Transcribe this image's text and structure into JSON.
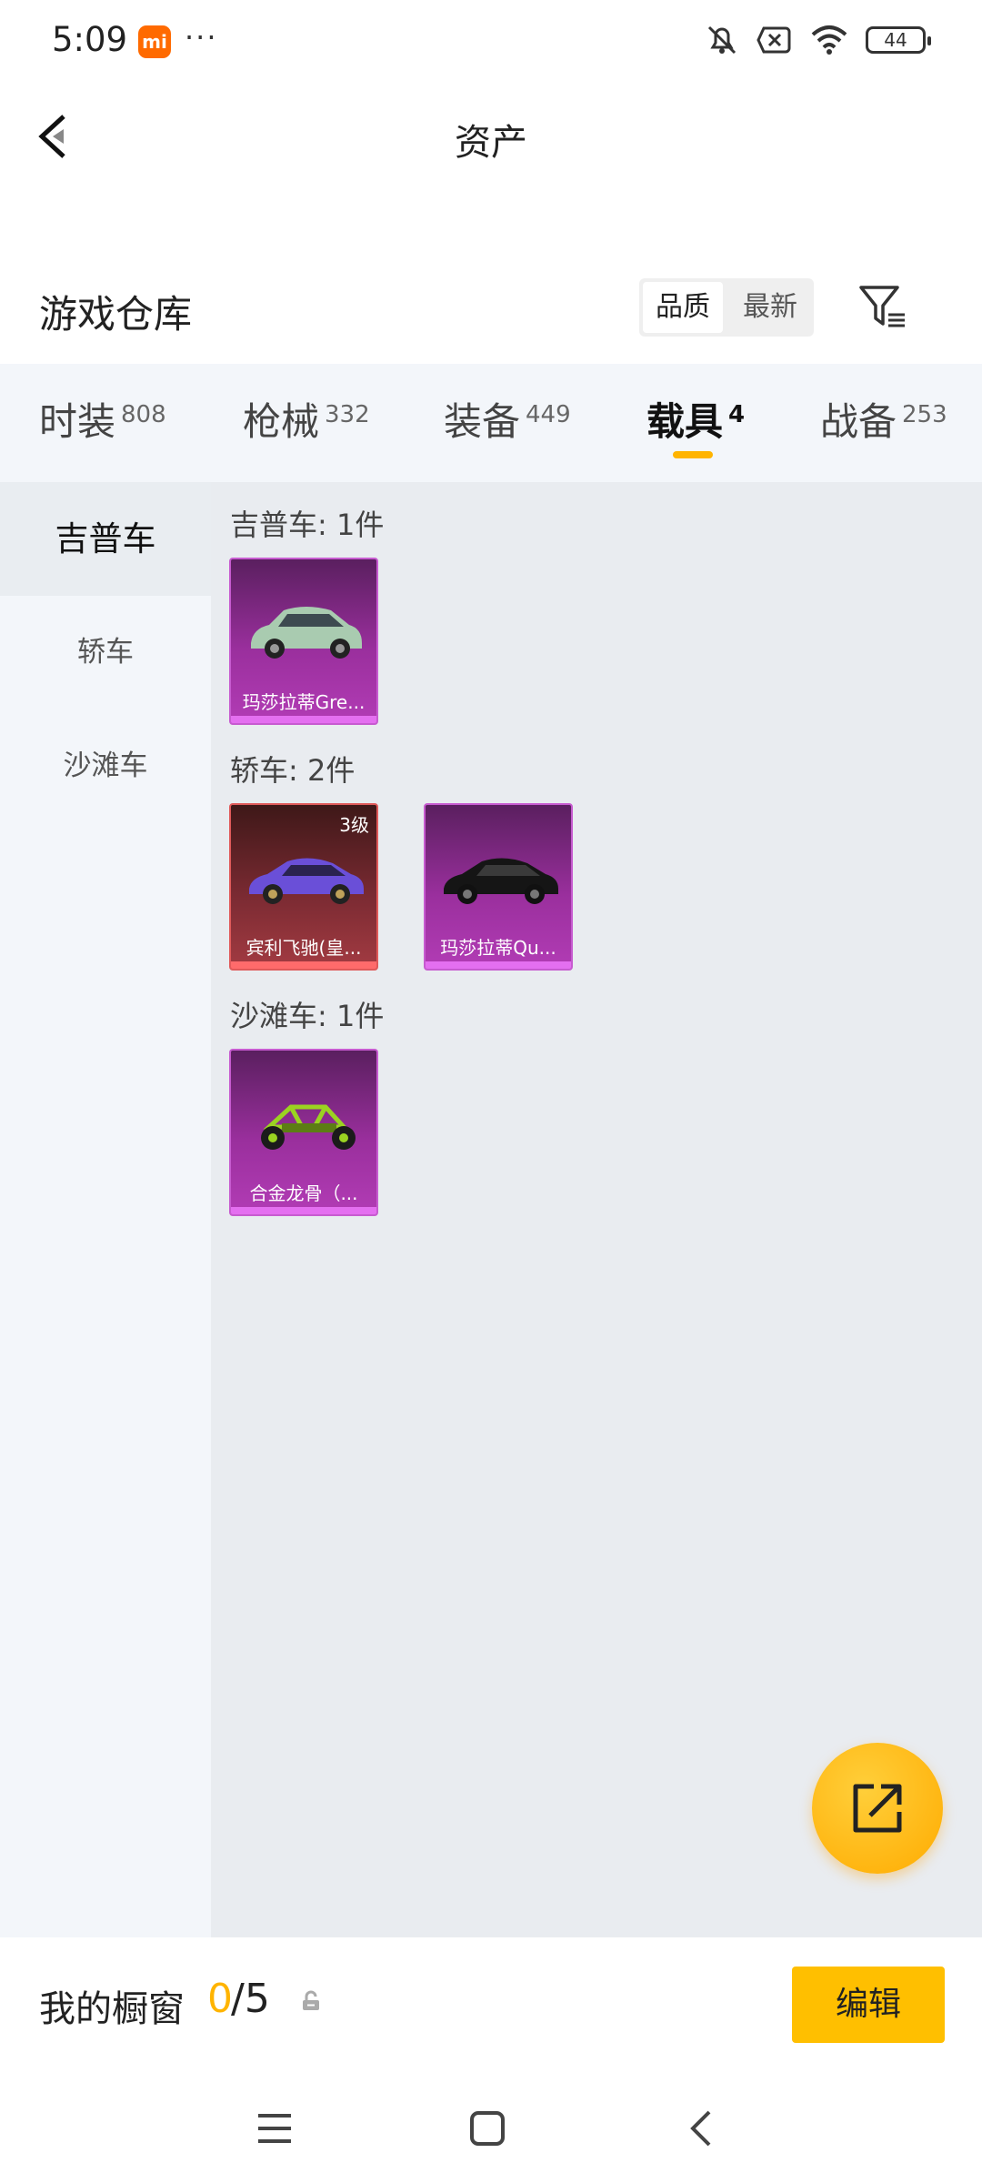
{
  "status_bar": {
    "time": "5:09",
    "app_badge": "mi",
    "more": "···",
    "battery": "44"
  },
  "header": {
    "title": "资产"
  },
  "warehouse": {
    "title": "游戏仓库",
    "sort_options": [
      "品质",
      "最新"
    ],
    "sort_selected": "品质"
  },
  "tabs": [
    {
      "label": "时装",
      "count": "808"
    },
    {
      "label": "枪械",
      "count": "332"
    },
    {
      "label": "装备",
      "count": "449"
    },
    {
      "label": "载具",
      "count": "4",
      "active": true
    },
    {
      "label": "战备",
      "count": "253"
    }
  ],
  "sidebar": {
    "items": [
      "吉普车",
      "轿车",
      "沙滩车"
    ],
    "selected": "吉普车"
  },
  "sections": [
    {
      "label": "吉普车: 1件",
      "items": [
        {
          "name": "玛莎拉蒂Gre...",
          "quality": "purple",
          "icon": "suv-icon"
        }
      ]
    },
    {
      "label": "轿车: 2件",
      "items": [
        {
          "name": "宾利飞驰(皇...",
          "quality": "red",
          "level": "3级",
          "icon": "sedan-icon"
        },
        {
          "name": "玛莎拉蒂Qu...",
          "quality": "purple",
          "icon": "sedan-icon"
        }
      ]
    },
    {
      "label": "沙滩车: 1件",
      "items": [
        {
          "name": "合金龙骨（...",
          "quality": "purple",
          "icon": "buggy-icon"
        }
      ]
    }
  ],
  "showcase": {
    "label": "我的橱窗",
    "current": "0",
    "total": "/5",
    "edit_label": "编辑"
  },
  "colors": {
    "accent": "#ffb400",
    "purple_quality": "#b23cb5",
    "red_quality": "#a33b42"
  }
}
